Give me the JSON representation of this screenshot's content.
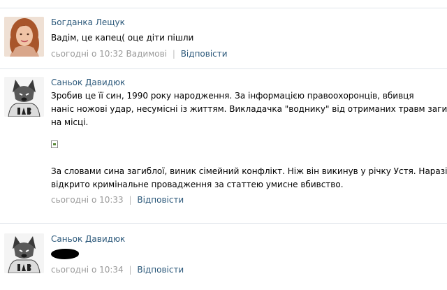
{
  "comments": [
    {
      "author": "Богданка Лещук",
      "text_lines": [
        "Вадім, це капец( оце діти пішли"
      ],
      "time": "сьогодні о 10:32",
      "addressee": "Вадимові",
      "reply_label": "Відповісти",
      "avatar_icon": "woman-photo"
    },
    {
      "author": "Саньок Давидюк",
      "paragraph1": [
        "Зробив це її син, 1990 року народження. За інформацією правоохоронців, вбивця",
        "наніс ножові удар, несумісні із життям. Викладачка \"воднику\" від отриманих травм загинула",
        "на місці."
      ],
      "paragraph2": [
        "За словами сина загиблої, виник сімейний конфлікт. Ніж він викинув у річку Устя. Наразі",
        "відкрито кримінальне провадження за статтею умисне вбивство."
      ],
      "time": "сьогодні о 10:33",
      "reply_label": "Відповісти",
      "avatar_icon": "wolf-shirt-icon"
    },
    {
      "author": "Саньок Давидюк",
      "time": "сьогодні о 10:34",
      "reply_label": "Відповісти",
      "avatar_icon": "wolf-shirt-icon"
    }
  ],
  "colors": {
    "link": "#2b587a",
    "meta": "#999999",
    "divider": "#dfe4ea"
  }
}
